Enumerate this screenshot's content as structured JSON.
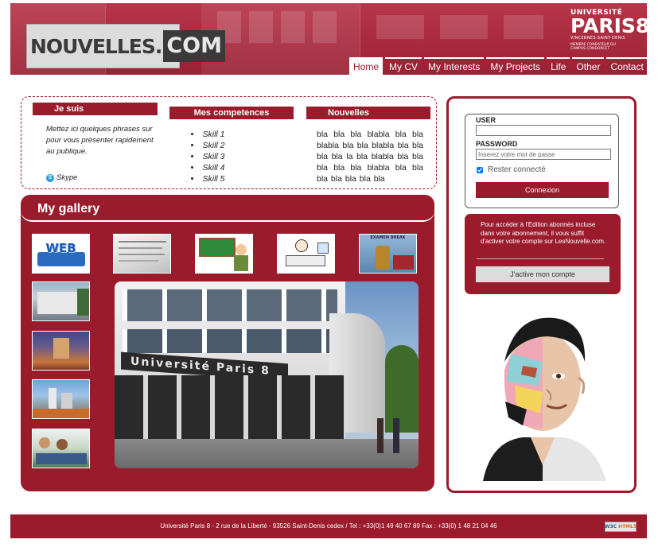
{
  "header": {
    "logo": {
      "part1": "NOUVELLES",
      "dot": ".",
      "part2": "COM"
    },
    "university": {
      "line1": "UNIVERSITÉ",
      "line2": "PARIS8",
      "line3": "VINCENNES-SAINT-DENIS",
      "line4": "MEMBRE FONDATEUR DU CAMPUS CONDORCET"
    },
    "nav": [
      "Home",
      "My CV",
      "My Interests",
      "My Projects",
      "Life",
      "Other",
      "Contact"
    ],
    "active_tab": "Home"
  },
  "about": {
    "jesuis": {
      "title": "Je suis",
      "text": "Mettez ici quelques phrases sur pour vous présenter rapidement au publique.",
      "skype": "Skype"
    },
    "competences": {
      "title": "Mes competences",
      "skills": [
        "Skill 1",
        "Skill 2",
        "Skill 3",
        "Skill 4",
        "Skill 5"
      ]
    },
    "nouvelles": {
      "title": "Nouvelles",
      "text": "bla bla bla blabla bla bla blabla bla bla blabla bla bla bla bla la bla blabla bla bla bla bla bla blabla bla bla bla bla bla bla bla"
    }
  },
  "gallery": {
    "title": "My gallery",
    "thumb_labels": {
      "web": "WEB",
      "exam": "EXAMEN BREAK"
    },
    "main_photo_sign": "Université Paris 8"
  },
  "login": {
    "user_label": "USER",
    "user_value": "",
    "password_label": "PASSWORD",
    "password_placeholder": "Inserez votre mot de passe",
    "remember_label": "Rester connecté",
    "remember_checked": true,
    "submit_label": "Connexion"
  },
  "promo": {
    "text": "Pour accéder à l'Edition abonnés incluse dans votre abonnement, il vous suffit d'activer votre compte sur LesNouvelle.com.",
    "button_label": "J'active mon compte"
  },
  "footer": {
    "text": "Université Paris 8 - 2 rue de la Liberté - 93526 Saint-Denis cedex / Tel : +33(0)1 49 40 67 89 Fax : +33(0) 1 48 21 04 46",
    "badge1": "W3C",
    "badge2": "HTML5"
  },
  "colors": {
    "primary": "#9a1b2c",
    "header": "#a82a3e",
    "button_secondary": "#dcdcdc"
  }
}
